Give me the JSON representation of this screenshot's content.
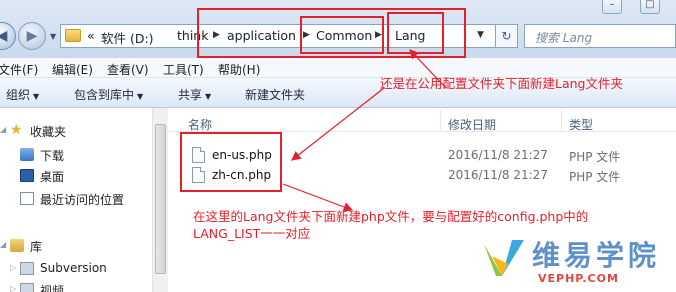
{
  "address": {
    "overflow": "«",
    "crumbs": [
      "软件 (D:)",
      "think",
      "application",
      "Common",
      "Lang"
    ],
    "search_placeholder": "搜索 Lang"
  },
  "window_controls": [
    "–",
    "□"
  ],
  "menu": [
    "文件(F)",
    "编辑(E)",
    "查看(V)",
    "工具(T)",
    "帮助(H)"
  ],
  "toolbar": {
    "organize": "组织",
    "include_in_library": "包含到库中",
    "share": "共享",
    "new_folder": "新建文件夹"
  },
  "nav": {
    "favorites": "收藏夹",
    "downloads": "下载",
    "desktop": "桌面",
    "recent": "最近访问的位置",
    "libraries": "库",
    "subversion": "Subversion",
    "videos": "视频"
  },
  "columns": {
    "name": "名称",
    "modified": "修改日期",
    "type": "类型"
  },
  "files": [
    {
      "name": "en-us.php",
      "modified": "2016/11/8 21:27",
      "type": "PHP 文件"
    },
    {
      "name": "zh-cn.php",
      "modified": "2016/11/8 21:27",
      "type": "PHP 文件"
    }
  ],
  "annotations": {
    "top_note": "还是在公用配置文件夹下面新建Lang文件夹",
    "bottom_note_line1": "在这里的Lang文件夹下面新建php文件，要与配置好的config.php中的",
    "bottom_note_line2": "LANG_LIST一一对应"
  },
  "watermark": {
    "title": "维易学院",
    "subtitle": "VEPHP.COM"
  },
  "colors": {
    "annotation_red": "#e4202a",
    "watermark_blue": "#5d91c8",
    "watermark_red": "#e0483d"
  }
}
